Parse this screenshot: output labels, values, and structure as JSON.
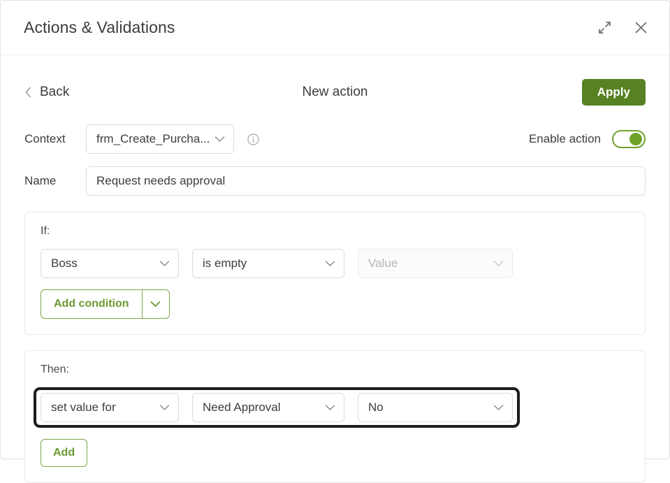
{
  "window": {
    "title": "Actions & Validations",
    "expand_icon": "expand-diagonal-icon",
    "close_icon": "close-icon"
  },
  "nav": {
    "back_label": "Back",
    "back_icon": "chevron-left-icon",
    "page_title": "New action",
    "apply_label": "Apply"
  },
  "context": {
    "label": "Context",
    "value": "frm_Create_Purcha...",
    "info_icon": "info-circle-icon",
    "enable_label": "Enable action",
    "enable_state": "on"
  },
  "name": {
    "label": "Name",
    "value": "Request needs approval",
    "placeholder": "Name"
  },
  "if_section": {
    "label": "If:",
    "condition": {
      "field": "Boss",
      "operator": "is empty",
      "value_placeholder": "Value",
      "value": ""
    },
    "add_condition_label": "Add condition"
  },
  "then_section": {
    "label": "Then:",
    "action": {
      "operation": "set value for",
      "target": "Need Approval",
      "value": "No"
    },
    "add_label": "Add"
  },
  "colors": {
    "accent_green": "#578223",
    "outline_green": "#7da646",
    "toggle_green": "#6fa12b",
    "focus_black": "#1c1c1c",
    "border_grey": "#dcdcdc",
    "text_dark": "#3d3d3d",
    "text_muted": "#b6b6b6"
  }
}
